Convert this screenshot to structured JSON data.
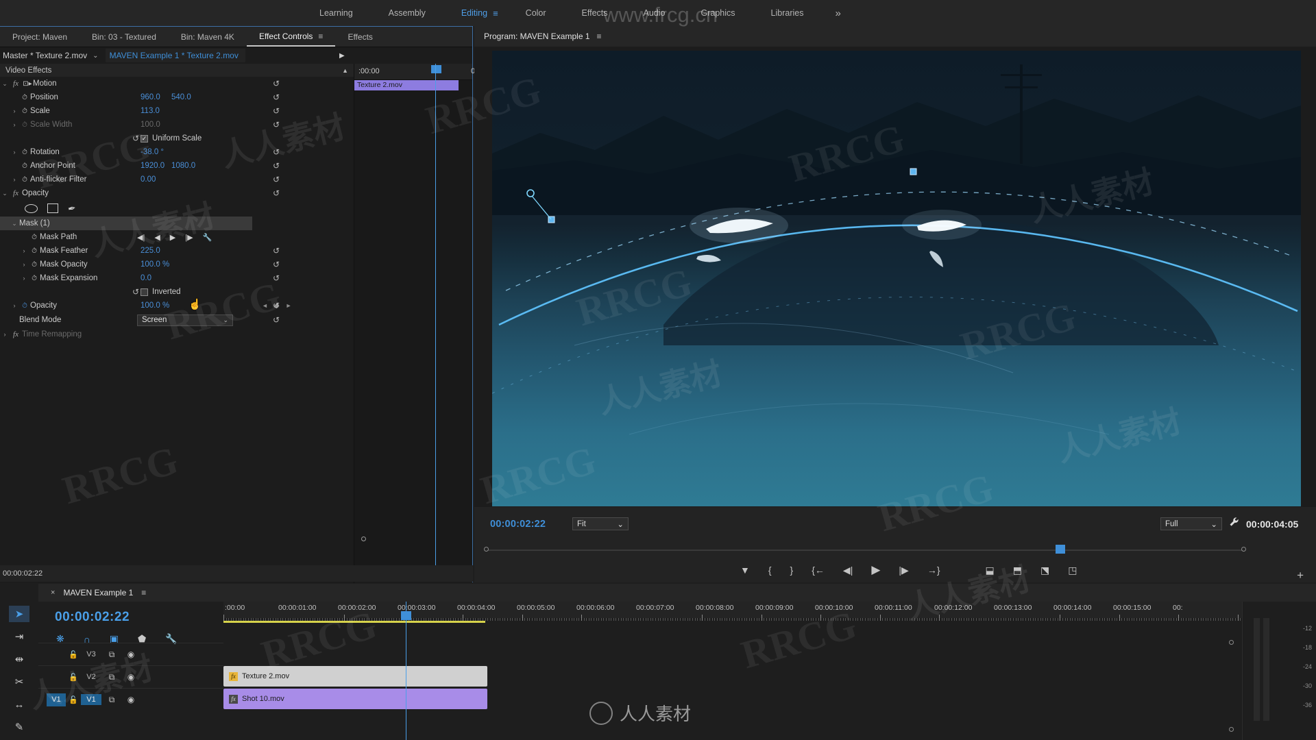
{
  "workspace": {
    "tabs": [
      {
        "label": "Learning",
        "active": false
      },
      {
        "label": "Assembly",
        "active": false
      },
      {
        "label": "Editing",
        "active": true
      },
      {
        "label": "Color",
        "active": false
      },
      {
        "label": "Effects",
        "active": false
      },
      {
        "label": "Audio",
        "active": false
      },
      {
        "label": "Graphics",
        "active": false
      },
      {
        "label": "Libraries",
        "active": false
      }
    ],
    "overflow": "»",
    "menu_icon": "≡"
  },
  "left_panel": {
    "tabs": [
      {
        "label": "Project: Maven",
        "active": false,
        "menu": ""
      },
      {
        "label": "Bin: 03 - Textured",
        "active": false,
        "menu": ""
      },
      {
        "label": "Bin: Maven 4K",
        "active": false,
        "menu": ""
      },
      {
        "label": "Effect Controls",
        "active": true,
        "menu": "≡"
      },
      {
        "label": "Effects",
        "active": false,
        "menu": ""
      }
    ],
    "clip_bar": {
      "master": "Master * Texture 2.mov",
      "chevron": "⌄",
      "sequence_clip": "MAVEN Example 1 * Texture 2.mov",
      "arrow": "▶"
    },
    "section_header": "Video Effects",
    "collapse_icon": "▲",
    "effects": [
      {
        "name": "Motion",
        "type": "group",
        "fx": "fx",
        "disclosure": "⌄",
        "box_icon": "⊡▸",
        "reset": "↺",
        "params": [
          {
            "label": "Position",
            "value": "960.0",
            "value2": "540.0",
            "disclosure": "",
            "stopwatch": "⏱",
            "reset": "↺",
            "dim": false
          },
          {
            "label": "Scale",
            "value": "113.0",
            "value2": "",
            "disclosure": "›",
            "stopwatch": "⏱",
            "reset": "↺",
            "dim": false
          },
          {
            "label": "Scale Width",
            "value": "100.0",
            "value2": "",
            "disclosure": "›",
            "stopwatch": "⏱",
            "reset": "↺",
            "dim": true
          },
          {
            "label": "Uniform Scale",
            "type": "checkbox",
            "checked": true,
            "reset": "↺"
          },
          {
            "label": "Rotation",
            "value": "-38.0 °",
            "value2": "",
            "disclosure": "›",
            "stopwatch": "⏱",
            "reset": "↺",
            "dim": false
          },
          {
            "label": "Anchor Point",
            "value": "1920.0",
            "value2": "1080.0",
            "disclosure": "",
            "stopwatch": "⏱",
            "reset": "↺",
            "dim": false
          },
          {
            "label": "Anti-flicker Filter",
            "value": "0.00",
            "value2": "",
            "disclosure": "›",
            "stopwatch": "⏱",
            "reset": "↺",
            "dim": false
          }
        ]
      },
      {
        "name": "Opacity",
        "type": "group",
        "fx": "fx",
        "disclosure": "⌄",
        "reset": "↺",
        "mask_tools": [
          "ellipse-mask",
          "rectangle-mask",
          "pen-mask"
        ],
        "mask_title": "Mask (1)",
        "mask_disclosure": "⌄",
        "params": [
          {
            "label": "Mask Path",
            "type": "maskpath",
            "buttons": [
              "◀|",
              "◀",
              "▶",
              "|▶",
              "🔧"
            ],
            "stopwatch": "⏱"
          },
          {
            "label": "Mask Feather",
            "value": "225.0",
            "disclosure": "›",
            "stopwatch": "⏱",
            "reset": "↺",
            "dim": false
          },
          {
            "label": "Mask Opacity",
            "value": "100.0 %",
            "disclosure": "›",
            "stopwatch": "⏱",
            "reset": "↺",
            "dim": false
          },
          {
            "label": "Mask Expansion",
            "value": "0.0",
            "disclosure": "›",
            "stopwatch": "⏱",
            "reset": "↺",
            "dim": false
          },
          {
            "label": "Inverted",
            "type": "checkbox",
            "checked": false,
            "reset": "↺"
          },
          {
            "label": "Opacity",
            "value": "100.0 %",
            "disclosure": "›",
            "stopwatch": "⏱",
            "reset": "↺",
            "keyframe_nav": [
              "◄",
              "◆",
              "►"
            ],
            "dim": false
          },
          {
            "label": "Blend Mode",
            "type": "select",
            "value": "Screen",
            "chevron": "⌄",
            "reset": "↺"
          }
        ]
      },
      {
        "name": "Time Remapping",
        "type": "group",
        "fx": "fx",
        "disclosure": "›",
        "dim": true
      }
    ],
    "mini_timeline": {
      "start_timecode": ":00:00",
      "mark_timecode": "0",
      "clip_label": "Texture 2.mov"
    },
    "footer_timecode": "00:00:02:22"
  },
  "program_monitor": {
    "title": "Program: MAVEN Example 1",
    "menu_icon": "≡",
    "timecode": "00:00:02:22",
    "fit_label": "Fit",
    "fit_chevron": "⌄",
    "quality_label": "Full",
    "quality_chevron": "⌄",
    "wrench_icon": "🔧",
    "duration": "00:00:04:05",
    "transport": [
      {
        "icon": "▼",
        "name": "add-marker"
      },
      {
        "icon": "{",
        "name": "mark-in"
      },
      {
        "icon": "}",
        "name": "mark-out"
      },
      {
        "icon": "{←",
        "name": "go-to-in"
      },
      {
        "icon": "◀|",
        "name": "step-back"
      },
      {
        "icon": "▶",
        "name": "play-stop"
      },
      {
        "icon": "|▶",
        "name": "step-forward"
      },
      {
        "icon": "→}",
        "name": "go-to-out"
      },
      {
        "icon": "⬓",
        "name": "lift"
      },
      {
        "icon": "⬒",
        "name": "extract"
      },
      {
        "icon": "⬔",
        "name": "export-frame"
      },
      {
        "icon": "◳",
        "name": "comparison-view"
      }
    ],
    "plus_icon": "+"
  },
  "timeline": {
    "tab_close": "×",
    "tab_label": "MAVEN Example 1",
    "tab_menu": "≡",
    "timecode": "00:00:02:22",
    "tool_icons": [
      {
        "name": "nest-sequence-icon",
        "glyph": "❋",
        "active": true
      },
      {
        "name": "snap-icon",
        "glyph": "∩",
        "active": true
      },
      {
        "name": "linked-selection-icon",
        "glyph": "▣",
        "active": true
      },
      {
        "name": "add-marker-icon",
        "glyph": "⬟",
        "active": false
      },
      {
        "name": "timeline-settings-icon",
        "glyph": "🔧",
        "active": false
      }
    ],
    "ruler_labels": [
      ":00:00",
      "00:00:01:00",
      "00:00:02:00",
      "00:00:03:00",
      "00:00:04:00",
      "00:00:05:00",
      "00:00:06:00",
      "00:00:07:00",
      "00:00:08:00",
      "00:00:09:00",
      "00:00:10:00",
      "00:00:11:00",
      "00:00:12:00",
      "00:00:13:00",
      "00:00:14:00",
      "00:00:15:00",
      "00:"
    ],
    "tracks": [
      {
        "name": "V3",
        "target": "",
        "targeted": false,
        "lock": "🔓",
        "sync": "⧉",
        "eye": "◉"
      },
      {
        "name": "V2",
        "target": "",
        "targeted": false,
        "lock": "🔓",
        "sync": "⧉",
        "eye": "◉"
      },
      {
        "name": "V1",
        "target": "V1",
        "targeted": true,
        "lock": "🔓",
        "sync": "⧉",
        "eye": "◉"
      }
    ],
    "clips": [
      {
        "track": "V2",
        "label": "Texture 2.mov",
        "color": "#d0d0d0",
        "text_color": "#1c1c1c",
        "fx_color": "#e8b53a",
        "fx": "fx"
      },
      {
        "track": "V1",
        "label": "Shot 10.mov",
        "color": "#a88ce8",
        "text_color": "#1c1c1c",
        "fx_color": "#4a4a4a",
        "fx": "fx"
      }
    ]
  },
  "tools_palette": [
    {
      "name": "selection-tool",
      "glyph": "➤",
      "active": true
    },
    {
      "name": "track-select-forward-tool",
      "glyph": "⇥",
      "active": false
    },
    {
      "name": "ripple-edit-tool",
      "glyph": "⇹",
      "active": false
    },
    {
      "name": "razor-tool",
      "glyph": "✂",
      "active": false
    },
    {
      "name": "slip-tool",
      "glyph": "↔",
      "active": false
    },
    {
      "name": "pen-tool",
      "glyph": "✎",
      "active": false
    }
  ],
  "audio_meters": {
    "labels": [
      "-12",
      "-18",
      "-24",
      "-30",
      "-36"
    ]
  },
  "watermarks": {
    "rrcg": "RRCG",
    "chinese": "人人素材",
    "url": "www.frcg.cn",
    "logo_text": "人人素材"
  },
  "colors": {
    "accent_blue": "#4a9fe8",
    "value_blue": "#4a8fd8",
    "panel_bg": "#1c1c1c",
    "toolbar_bg": "#262626",
    "workarea_yellow": "#d6d24a",
    "clip_purple": "#a88ce8"
  }
}
